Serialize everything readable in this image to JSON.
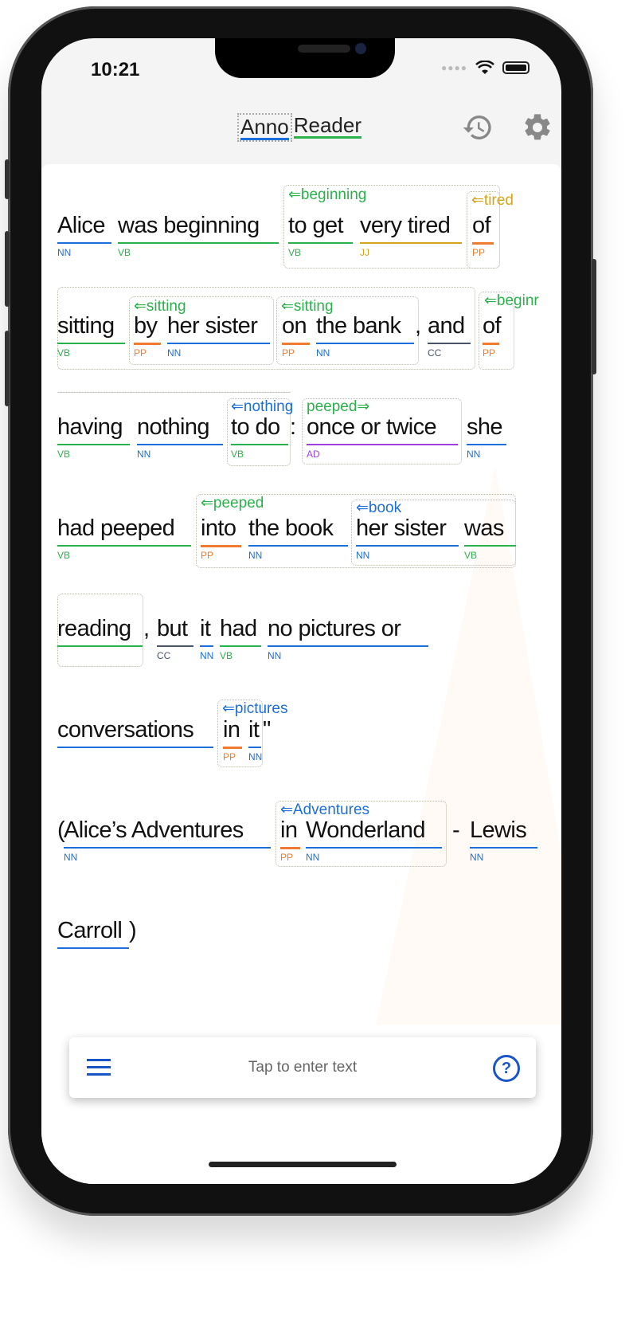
{
  "status_bar": {
    "time": "10:21",
    "signal_icon": "dots-icon",
    "wifi_icon": "wifi-icon",
    "battery_icon": "battery-icon"
  },
  "header": {
    "title_part1": "Anno",
    "title_part2": "Reader",
    "history_icon": "history-icon",
    "settings_icon": "gear-icon"
  },
  "colors": {
    "NN": "#1a6fdc",
    "VB": "#2ab24a",
    "JJ": "#d4a51a",
    "PP": "#f07a30",
    "CC": "#4a5468",
    "AD": "#a040e0",
    "accent": "#1a55c8"
  },
  "text_lines": [
    [
      {
        "text": "Alice",
        "tag": "NN"
      },
      {
        "text": "was beginning",
        "tag": "VB"
      },
      {
        "text": "to get",
        "tag": "VB"
      },
      {
        "text": "very tired",
        "tag": "JJ"
      },
      {
        "text": "of",
        "tag": "PP"
      }
    ],
    [
      {
        "text": "sitting",
        "tag": "VB"
      },
      {
        "text": "by",
        "tag": "PP"
      },
      {
        "text": "her sister",
        "tag": "NN"
      },
      {
        "text": "on",
        "tag": "PP"
      },
      {
        "text": "the bank",
        "tag": "NN"
      },
      {
        "text": ","
      },
      {
        "text": "and",
        "tag": "CC"
      },
      {
        "text": "of",
        "tag": "PP"
      }
    ],
    [
      {
        "text": "having",
        "tag": "VB"
      },
      {
        "text": "nothing",
        "tag": "NN"
      },
      {
        "text": "to do",
        "tag": "VB"
      },
      {
        "text": ":"
      },
      {
        "text": "once or twice",
        "tag": "AD"
      },
      {
        "text": "she",
        "tag": "NN"
      }
    ],
    [
      {
        "text": "had peeped",
        "tag": "VB"
      },
      {
        "text": "into",
        "tag": "PP"
      },
      {
        "text": "the book",
        "tag": "NN"
      },
      {
        "text": "her sister",
        "tag": "NN"
      },
      {
        "text": "was",
        "tag": "VB"
      }
    ],
    [
      {
        "text": "reading",
        "underline": "VB"
      },
      {
        "text": ","
      },
      {
        "text": "but",
        "tag": "CC"
      },
      {
        "text": "it",
        "tag": "NN"
      },
      {
        "text": "had",
        "tag": "VB"
      },
      {
        "text": "no pictures or",
        "tag": "NN"
      }
    ],
    [
      {
        "text": "conversations",
        "underline": "NN"
      },
      {
        "text": "in",
        "tag": "PP"
      },
      {
        "text": "it",
        "tag": "NN"
      },
      {
        "text": "\""
      }
    ],
    [
      {
        "text": "("
      },
      {
        "text": "Alice’s Adventures",
        "tag": "NN"
      },
      {
        "text": "in",
        "tag": "PP"
      },
      {
        "text": "Wonderland",
        "tag": "NN"
      },
      {
        "text": "-"
      },
      {
        "text": "Lewis",
        "tag": "NN"
      }
    ],
    [
      {
        "text": "Carroll",
        "underline": "NN"
      },
      {
        "text": ")"
      }
    ]
  ],
  "annotations": [
    {
      "label": "⇐beginning",
      "color": "VB"
    },
    {
      "label": "⇐tired",
      "color": "JJ"
    },
    {
      "label": "",
      "color": "VB"
    },
    {
      "label": "⇐sitting",
      "color": "VB"
    },
    {
      "label": "⇐sitting",
      "color": "VB"
    },
    {
      "label": "⇐beginr",
      "color": "VB"
    },
    {
      "label": "",
      "color": "VB"
    },
    {
      "label": "⇐nothing",
      "color": "NN"
    },
    {
      "label": "peeped⇒",
      "color": "VB"
    },
    {
      "label": "⇐peeped",
      "color": "VB"
    },
    {
      "label": "⇐book",
      "color": "NN"
    },
    {
      "label": "",
      "color": "VB"
    },
    {
      "label": "⇐pictures",
      "color": "NN"
    },
    {
      "label": "⇐Adventures",
      "color": "NN"
    }
  ],
  "input_bar": {
    "menu_icon": "menu-icon",
    "placeholder": "Tap to enter text",
    "help_icon": "help-icon"
  }
}
